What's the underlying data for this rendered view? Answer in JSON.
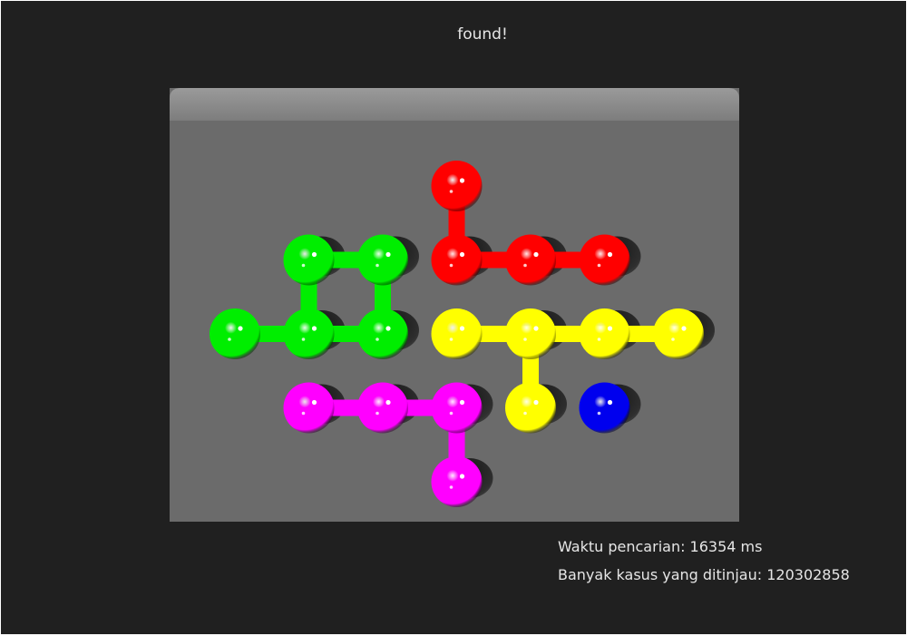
{
  "status_text": "found!",
  "stats": {
    "time_label": "Waktu pencarian: 16354 ms",
    "cases_label": "Banyak kasus yang ditinjau: 120302858"
  },
  "board": {
    "columns": 6,
    "rows": 5,
    "board_color": "#6b6b6b",
    "lip_color": "#8a8a8a",
    "hole_color": "#2a2a2a",
    "pieces": [
      {
        "name": "red",
        "color": "#ff0000",
        "cells": [
          [
            3,
            0
          ],
          [
            3,
            1
          ],
          [
            4,
            1
          ],
          [
            5,
            1
          ]
        ],
        "links": [
          [
            [
              3,
              0
            ],
            [
              3,
              1
            ]
          ],
          [
            [
              3,
              1
            ],
            [
              4,
              1
            ]
          ],
          [
            [
              4,
              1
            ],
            [
              5,
              1
            ]
          ]
        ]
      },
      {
        "name": "green",
        "color": "#00ee00",
        "cells": [
          [
            1,
            1
          ],
          [
            2,
            1
          ],
          [
            0,
            2
          ],
          [
            1,
            2
          ],
          [
            2,
            2
          ]
        ],
        "links": [
          [
            [
              1,
              1
            ],
            [
              2,
              1
            ]
          ],
          [
            [
              1,
              1
            ],
            [
              1,
              2
            ]
          ],
          [
            [
              2,
              1
            ],
            [
              2,
              2
            ]
          ],
          [
            [
              0,
              2
            ],
            [
              1,
              2
            ]
          ],
          [
            [
              1,
              2
            ],
            [
              2,
              2
            ]
          ]
        ]
      },
      {
        "name": "yellow",
        "color": "#ffff00",
        "cells": [
          [
            3,
            2
          ],
          [
            4,
            2
          ],
          [
            5,
            2
          ],
          [
            6,
            2
          ],
          [
            4,
            3
          ]
        ],
        "links": [
          [
            [
              3,
              2
            ],
            [
              4,
              2
            ]
          ],
          [
            [
              4,
              2
            ],
            [
              5,
              2
            ]
          ],
          [
            [
              5,
              2
            ],
            [
              6,
              2
            ]
          ],
          [
            [
              4,
              2
            ],
            [
              4,
              3
            ]
          ]
        ]
      },
      {
        "name": "magenta",
        "color": "#ff00ff",
        "cells": [
          [
            1,
            3
          ],
          [
            2,
            3
          ],
          [
            3,
            3
          ],
          [
            3,
            4
          ]
        ],
        "links": [
          [
            [
              1,
              3
            ],
            [
              2,
              3
            ]
          ],
          [
            [
              2,
              3
            ],
            [
              3,
              3
            ]
          ],
          [
            [
              3,
              3
            ],
            [
              3,
              4
            ]
          ]
        ]
      },
      {
        "name": "blue",
        "color": "#0000ee",
        "cells": [
          [
            5,
            3
          ]
        ],
        "links": []
      }
    ],
    "holes": [
      [
        3,
        1
      ],
      [
        4,
        1
      ],
      [
        5,
        1
      ],
      [
        1,
        1
      ],
      [
        2,
        1
      ],
      [
        1,
        2
      ],
      [
        2,
        2
      ],
      [
        4,
        2
      ],
      [
        5,
        2
      ],
      [
        6,
        2
      ],
      [
        1,
        3
      ],
      [
        2,
        3
      ],
      [
        3,
        3
      ],
      [
        4,
        3
      ],
      [
        5,
        3
      ],
      [
        3,
        4
      ]
    ]
  }
}
